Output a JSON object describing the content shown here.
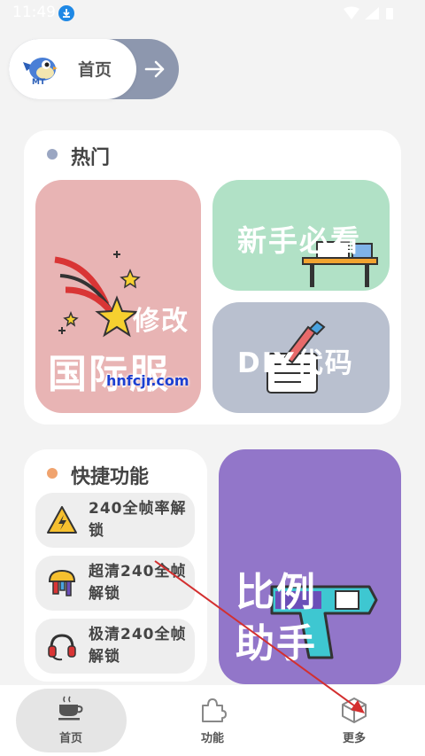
{
  "status_bar": {
    "time": "11:49"
  },
  "top_pill": {
    "title": "首页",
    "logo_text": "MT"
  },
  "hot": {
    "title": "热门",
    "tiles": {
      "pink_line1": "修改",
      "pink_line2": "国际服",
      "green": "新手必看",
      "gray": "DIY代码"
    },
    "watermark": "hnfcjr.com"
  },
  "quick": {
    "title": "快捷功能",
    "items": [
      {
        "label": "240全帧率解锁",
        "icon": "warning-icon"
      },
      {
        "label": "超清240全帧解锁",
        "icon": "paint-brush-icon"
      },
      {
        "label": "极清240全帧解锁",
        "icon": "headset-icon"
      }
    ]
  },
  "ratio_tile": {
    "line1": "比例",
    "line2": "助手"
  },
  "nav": {
    "items": [
      {
        "label": "首页",
        "icon": "coffee-cup-icon",
        "active": true
      },
      {
        "label": "功能",
        "icon": "puzzle-icon",
        "active": false
      },
      {
        "label": "更多",
        "icon": "cube-icon",
        "active": false
      }
    ]
  },
  "colors": {
    "pink": "#e8b4b4",
    "green": "#b1e1c6",
    "gray": "#b9c0cf",
    "purple": "#9276c9",
    "arrow": "#d32f2f"
  }
}
